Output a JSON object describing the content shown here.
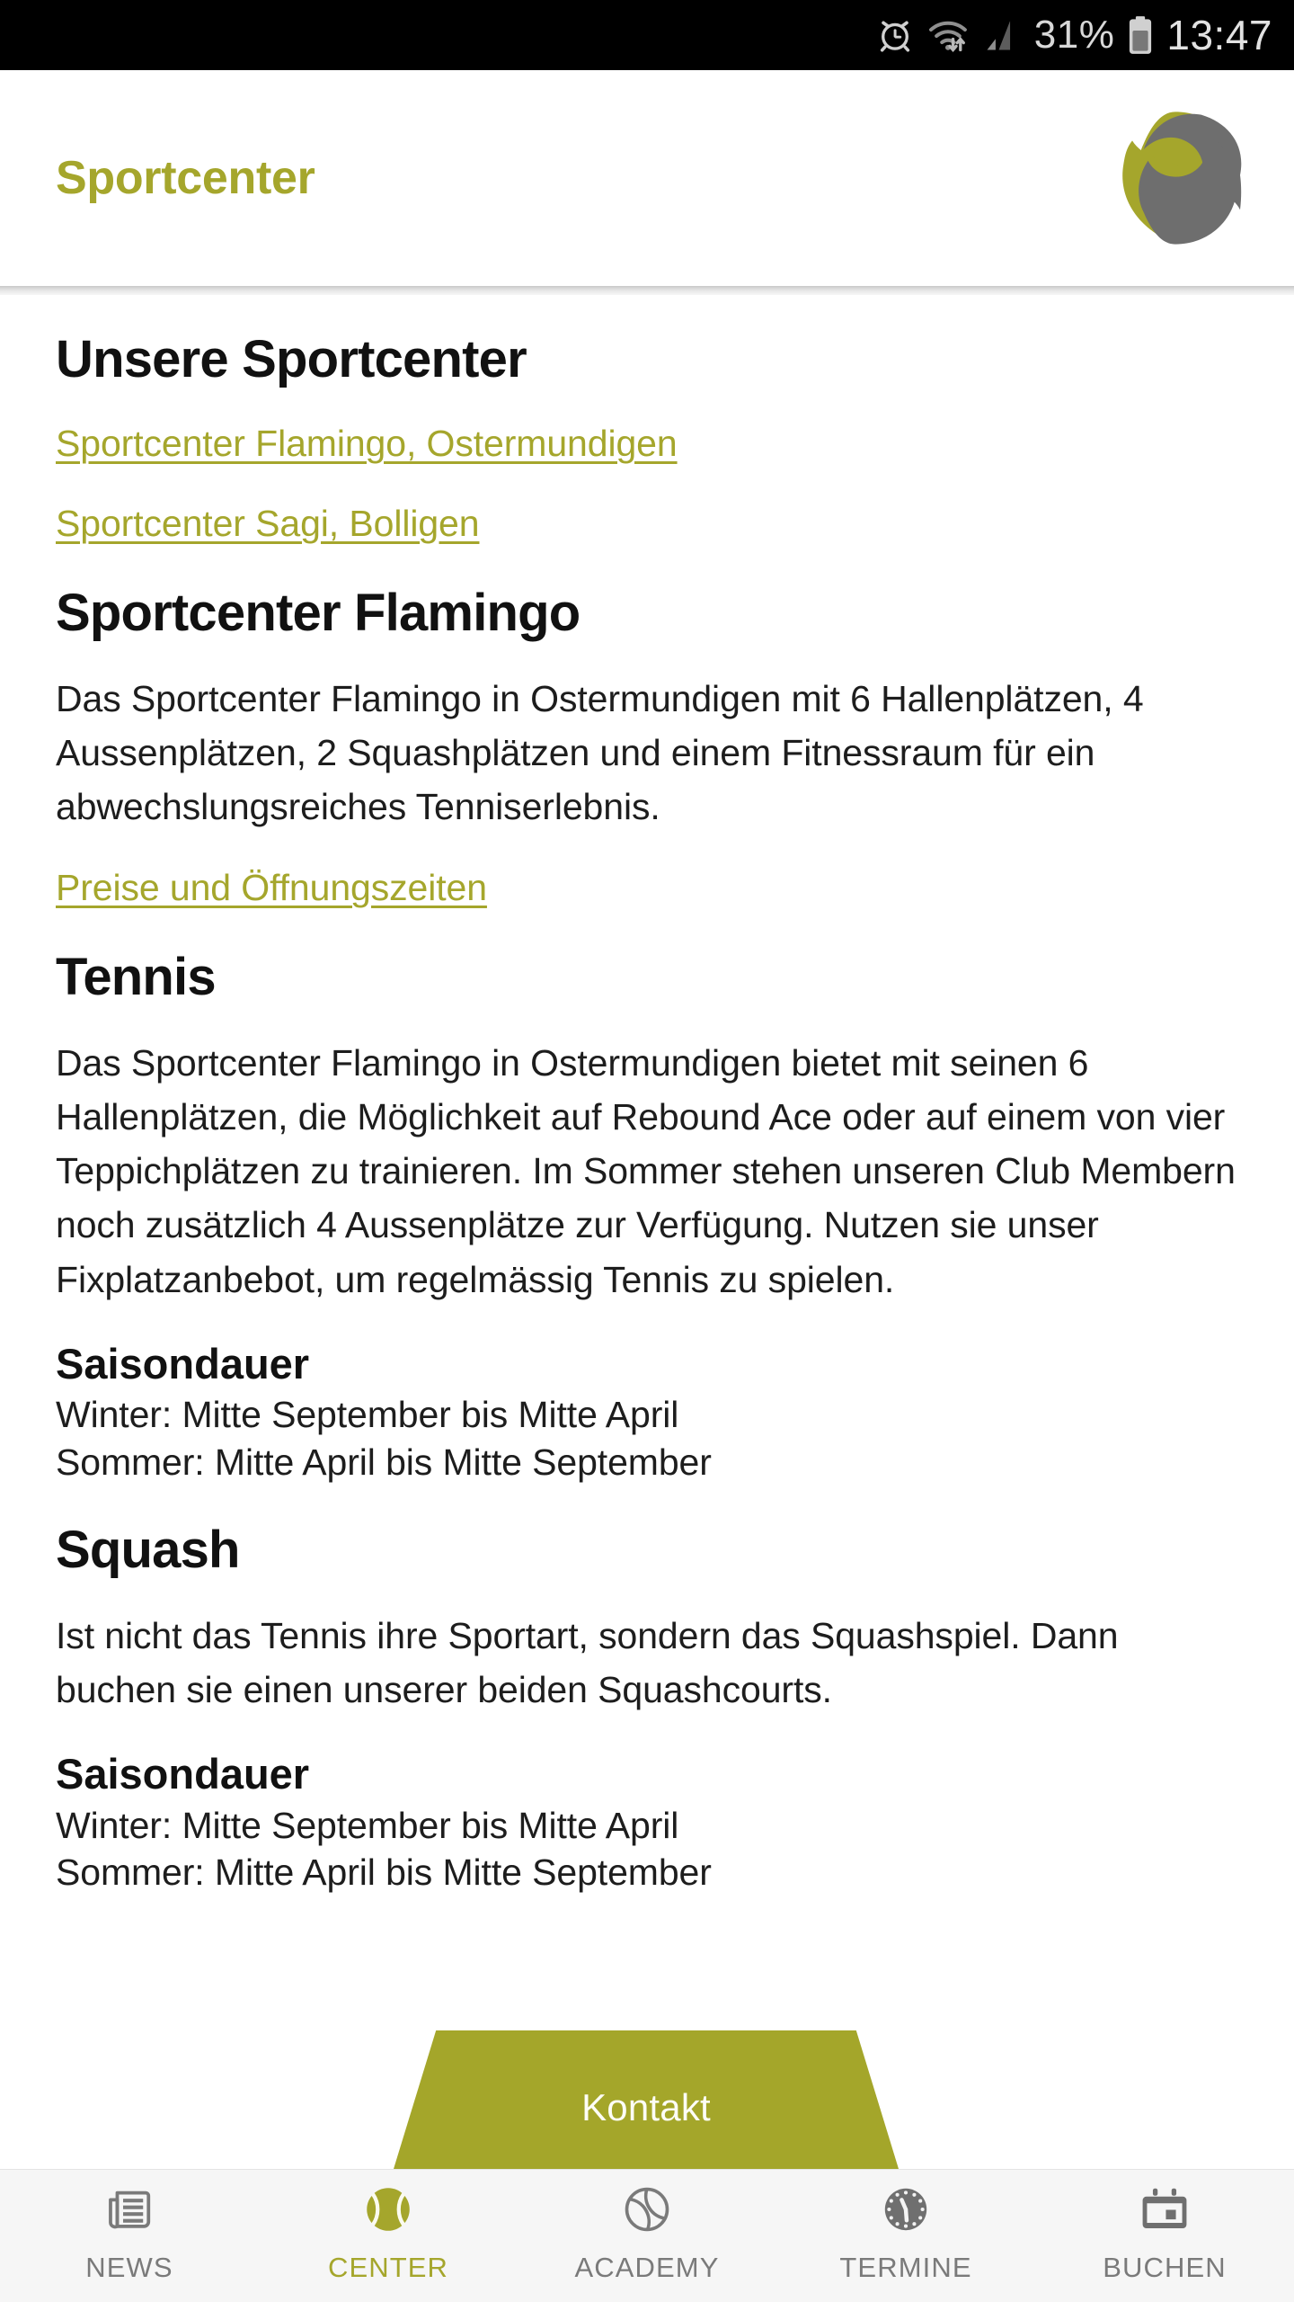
{
  "status_bar": {
    "icons": [
      "alarm-clock-icon",
      "wifi-icon",
      "cellular-signal-icon",
      "battery-icon"
    ],
    "battery_percent": "31%",
    "time": "13:47"
  },
  "header": {
    "title": "Sportcenter",
    "logo_name": "sportcenter-logo",
    "logo_colors": {
      "primary": "#a5a62c",
      "secondary": "#6e6e6e"
    }
  },
  "colors": {
    "accent_olive": "#a5a62c",
    "kontakt_button": "#a4a62a",
    "text_primary": "#111111",
    "nav_inactive": "#7a7a7a",
    "status_bar_bg": "#000000"
  },
  "content": {
    "page_heading": "Unsere Sportcenter",
    "center_links": [
      "Sportcenter Flamingo, Ostermundigen",
      "Sportcenter Sagi, Bolligen"
    ],
    "flamingo": {
      "heading": "Sportcenter Flamingo",
      "description": "Das Sportcenter Flamingo in Ostermundigen mit 6 Hallenplätzen, 4 Aussenplätzen, 2 Squashplätzen und einem Fitnessraum für ein abwechslungsreiches Tenniserlebnis.",
      "prices_link": "Preise und Öffnungszeiten"
    },
    "tennis": {
      "heading": "Tennis",
      "description": "Das Sportcenter Flamingo in Ostermundigen bietet mit seinen 6 Hallenplätzen, die Möglichkeit auf Rebound Ace oder auf einem von vier Teppichplätzen zu trainieren. Im Sommer stehen unseren Club Membern noch zusätzlich 4 Aussenplätze zur Verfügung. Nutzen sie unser Fixplatzanbebot, um regelmässig Tennis zu spielen.",
      "season_label": "Saisondauer",
      "season_winter": "Winter: Mitte September bis Mitte April",
      "season_summer": "Sommer: Mitte April bis Mitte September"
    },
    "squash": {
      "heading": "Squash",
      "description": "Ist nicht das Tennis ihre Sportart, sondern das Squashspiel. Dann buchen sie einen unserer beiden Squashcourts.",
      "season_label": "Saisondauer",
      "season_winter": "Winter: Mitte September bis Mitte April",
      "season_summer": "Sommer: Mitte April bis Mitte September"
    }
  },
  "kontakt_button": {
    "label": "Kontakt"
  },
  "bottom_nav": {
    "items": [
      {
        "label": "NEWS",
        "icon": "newspaper-icon",
        "active": false
      },
      {
        "label": "CENTER",
        "icon": "tennis-ball-filled-icon",
        "active": true
      },
      {
        "label": "ACADEMY",
        "icon": "tennis-ball-outline-icon",
        "active": false
      },
      {
        "label": "TERMINE",
        "icon": "clock-icon",
        "active": false
      },
      {
        "label": "BUCHEN",
        "icon": "calendar-icon",
        "active": false
      }
    ]
  }
}
